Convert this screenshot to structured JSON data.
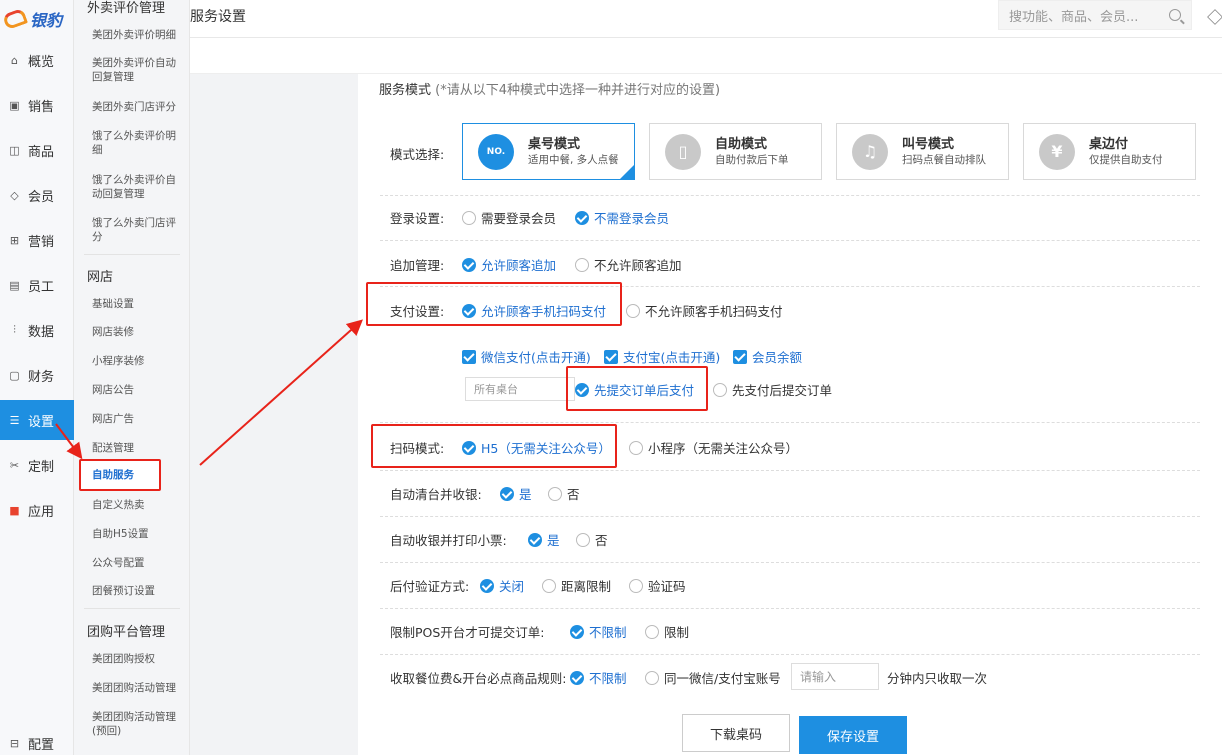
{
  "brand": {
    "logo_text": "银豹"
  },
  "rail": {
    "items": [
      {
        "label": "概览",
        "icon": "home-icon"
      },
      {
        "label": "销售",
        "icon": "sales-icon"
      },
      {
        "label": "商品",
        "icon": "goods-icon"
      },
      {
        "label": "会员",
        "icon": "member-icon"
      },
      {
        "label": "营销",
        "icon": "marketing-icon"
      },
      {
        "label": "员工",
        "icon": "staff-icon"
      },
      {
        "label": "数据",
        "icon": "data-icon"
      },
      {
        "label": "财务",
        "icon": "finance-icon"
      },
      {
        "label": "设置",
        "icon": "settings-icon",
        "active": true
      },
      {
        "label": "定制",
        "icon": "custom-icon"
      },
      {
        "label": "应用",
        "icon": "apps-icon"
      }
    ],
    "bottom": {
      "label": "配置",
      "icon": "config-icon"
    }
  },
  "submenu": {
    "group1_title": "外卖评价管理",
    "group1": [
      "美团外卖评价明细",
      "美团外卖评价自动回复管理",
      "美团外卖门店评分",
      "饿了么外卖评价明细",
      "饿了么外卖评价自动回复管理",
      "饿了么外卖门店评分"
    ],
    "group2_title": "网店",
    "group2": [
      "基础设置",
      "网店装修",
      "小程序装修",
      "网店公告",
      "网店广告",
      "配送管理",
      "自助服务",
      "自定义热卖",
      "自助H5设置",
      "公众号配置",
      "团餐预订设置"
    ],
    "group3_title": "团购平台管理",
    "group3": [
      "美团团购授权",
      "美团团购活动管理",
      "美团团购活动管理(预回)"
    ]
  },
  "header": {
    "title": "服务设置",
    "search_placeholder": "搜功能、商品、会员..."
  },
  "panel": {
    "heading": "服务模式",
    "heading_note": "(*请从以下4种模式中选择一种并进行对应的设置)",
    "mode_label": "模式选择:",
    "modes": [
      {
        "name": "桌号模式",
        "desc": "适用中餐, 多人点餐",
        "icon": "NO."
      },
      {
        "name": "自助模式",
        "desc": "自助付款后下单",
        "icon": "▯"
      },
      {
        "name": "叫号模式",
        "desc": "扫码点餐自动排队",
        "icon": "♫"
      },
      {
        "name": "桌边付",
        "desc": "仅提供自助支付",
        "icon": "¥"
      }
    ],
    "login": {
      "label": "登录设置:",
      "opt1": "需要登录会员",
      "opt2": "不需登录会员"
    },
    "addon": {
      "label": "追加管理:",
      "opt1": "允许顾客追加",
      "opt2": "不允许顾客追加"
    },
    "pay": {
      "label": "支付设置:",
      "opt1": "允许顾客手机扫码支付",
      "opt2": "不允许顾客手机扫码支付"
    },
    "pay_methods": [
      "微信支付(点击开通)",
      "支付宝(点击开通)",
      "会员余额"
    ],
    "table_select": "所有桌台",
    "order_flow": {
      "opt1": "先提交订单后支付",
      "opt2": "先支付后提交订单"
    },
    "scan": {
      "label": "扫码模式:",
      "opt1": "H5（无需关注公众号）",
      "opt2": "小程序（无需关注公众号）"
    },
    "auto_clear": {
      "label": "自动清台并收银:",
      "yes": "是",
      "no": "否"
    },
    "auto_print": {
      "label": "自动收银并打印小票:",
      "yes": "是",
      "no": "否"
    },
    "verify": {
      "label": "后付验证方式:",
      "opt1": "关闭",
      "opt2": "距离限制",
      "opt3": "验证码"
    },
    "pos_limit": {
      "label": "限制POS开台才可提交订单:",
      "opt1": "不限制",
      "opt2": "限制"
    },
    "fee_rule": {
      "label": "收取餐位费&开台必点商品规则:",
      "opt1": "不限制",
      "opt2": "同一微信/支付宝账号",
      "input_placeholder": "请输入",
      "suffix": "分钟内只收取一次"
    },
    "download_button": "下载桌码",
    "save_button": "保存设置"
  },
  "colors": {
    "accent": "#1e8fe1",
    "highlight": "#e8231a"
  }
}
